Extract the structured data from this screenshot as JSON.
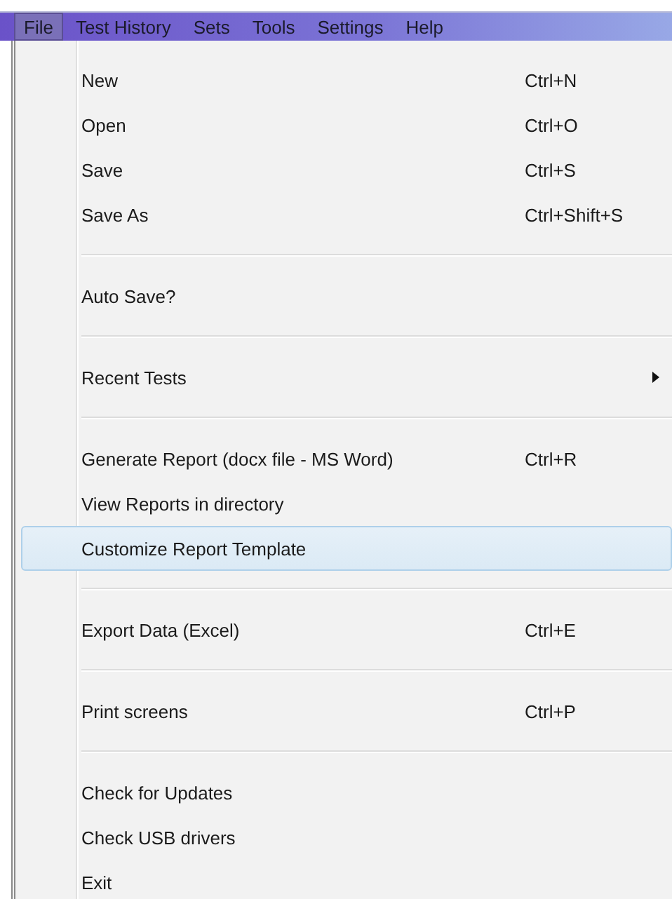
{
  "menubar": [
    {
      "label": "File",
      "selected": true
    },
    {
      "label": "Test History",
      "selected": false
    },
    {
      "label": "Sets",
      "selected": false
    },
    {
      "label": "Tools",
      "selected": false
    },
    {
      "label": "Settings",
      "selected": false
    },
    {
      "label": "Help",
      "selected": false
    }
  ],
  "menu": {
    "items": [
      {
        "kind": "item",
        "label": "New",
        "shortcut": "Ctrl+N",
        "selected": false,
        "submenu": false
      },
      {
        "kind": "item",
        "label": "Open",
        "shortcut": "Ctrl+O",
        "selected": false,
        "submenu": false
      },
      {
        "kind": "item",
        "label": "Save",
        "shortcut": "Ctrl+S",
        "selected": false,
        "submenu": false
      },
      {
        "kind": "item",
        "label": "Save As",
        "shortcut": "Ctrl+Shift+S",
        "selected": false,
        "submenu": false
      },
      {
        "kind": "separator"
      },
      {
        "kind": "item",
        "label": "Auto Save?",
        "selected": false,
        "submenu": false
      },
      {
        "kind": "separator"
      },
      {
        "kind": "item",
        "label": "Recent Tests",
        "selected": false,
        "submenu": true
      },
      {
        "kind": "separator"
      },
      {
        "kind": "item",
        "label": "Generate Report (docx file - MS Word)",
        "shortcut": "Ctrl+R",
        "selected": false,
        "submenu": false
      },
      {
        "kind": "item",
        "label": "View Reports in directory",
        "selected": false,
        "submenu": false
      },
      {
        "kind": "item",
        "label": "Customize Report Template",
        "selected": true,
        "submenu": false
      },
      {
        "kind": "separator"
      },
      {
        "kind": "item",
        "label": "Export Data (Excel)",
        "shortcut": "Ctrl+E",
        "selected": false,
        "submenu": false
      },
      {
        "kind": "separator"
      },
      {
        "kind": "item",
        "label": "Print screens",
        "shortcut": "Ctrl+P",
        "selected": false,
        "submenu": false
      },
      {
        "kind": "separator"
      },
      {
        "kind": "item",
        "label": "Check for Updates",
        "selected": false,
        "submenu": false
      },
      {
        "kind": "item",
        "label": "Check USB drivers",
        "selected": false,
        "submenu": false
      },
      {
        "kind": "item",
        "label": "Exit",
        "selected": false,
        "submenu": false
      }
    ]
  }
}
